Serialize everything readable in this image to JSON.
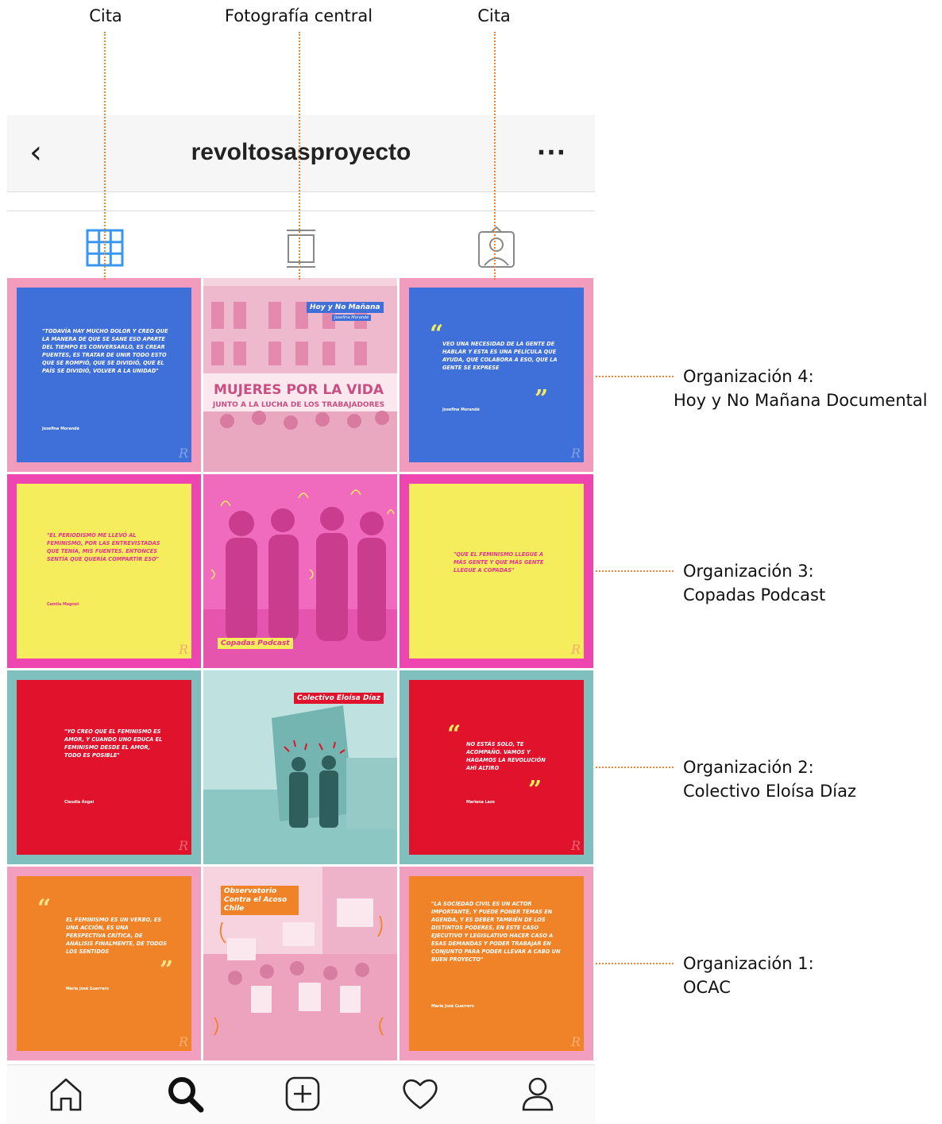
{
  "annotations": {
    "top_labels": [
      "Cita",
      "Fotografía central",
      "Cita"
    ],
    "side_labels": [
      {
        "line1": "Organización 4:",
        "line2": "Hoy y No Mañana Documental"
      },
      {
        "line1": "Organización 3:",
        "line2": "Copadas Podcast"
      },
      {
        "line1": "Organización 2:",
        "line2": "Colectivo Eloísa Díaz"
      },
      {
        "line1": "Organización 1:",
        "line2": "OCAC"
      }
    ],
    "line_color": "#e8873a"
  },
  "header": {
    "back_icon": "chevron-left-icon",
    "username": "revoltosasproyecto",
    "more_label": "···"
  },
  "tabs": [
    {
      "name": "grid",
      "icon": "grid-icon",
      "active": true
    },
    {
      "name": "feed",
      "icon": "single-post-icon",
      "active": false
    },
    {
      "name": "tagged",
      "icon": "tagged-person-icon",
      "active": false
    }
  ],
  "rows": [
    {
      "left": {
        "text": "\"Todavía hay mucho dolor y creo que la manera de que se sane eso aparte del tiempo es conversarlo, es crear puentes, es tratar de unir todo esto que se rompió, que se dividió, que el país se dividió, volver a la unidad\"",
        "author": "Josefina Morandé"
      },
      "center": {
        "tag": "Hoy y No Mañana",
        "subtag": "Josefina Morandé",
        "banner": "MUJERES POR LA VIDA",
        "banner2": "JUNTO A LA LUCHA DE LOS TRABAJADORES"
      },
      "right": {
        "text": "Veo una necesidad de la gente de hablar y esta es una película que ayuda, que colabora a eso, que la gente se exprese",
        "author": "Josefina Morandé"
      }
    },
    {
      "left": {
        "text": "\"El periodismo me llevó al feminismo, por las entrevistadas que tenía, mis fuentes. Entonces sentía que quería compartir eso\"",
        "author": "Camila Magnet"
      },
      "center": {
        "tag": "Copadas Podcast"
      },
      "right": {
        "text": "\"Que el feminismo llegue a más gente y que más gente llegue a Copadas\"",
        "author": ""
      }
    },
    {
      "left": {
        "text": "\"Yo creo que el feminismo es amor, y cuando uno educa el feminismo desde el amor, todo es posible\"",
        "author": "Claudia Ángel"
      },
      "center": {
        "tag": "Colectivo Eloísa Díaz"
      },
      "right": {
        "text": "No estás solo, te acompaño. Vamos y hagamos la revolución ahí altiro",
        "author": "Mariana Lazo"
      }
    },
    {
      "left": {
        "text": "El feminismo es un verbo, es una acción, es una perspectiva crítica, de análisis finalmente, de todos los sentidos",
        "author": "María José Guerrero"
      },
      "center": {
        "tag": "Observatorio Contra el Acoso Chile"
      },
      "right": {
        "text": "\"La sociedad civil es un actor importante, y puede poner temas en agenda, y es deber también de los distintos poderes, en este caso ejecutivo y legislativo hacer caso a esas demandas y poder trabajar en conjunto para poder llevar a cabo un buen proyecto\"",
        "author": "María José Guerrero"
      }
    }
  ],
  "colors": {
    "row1_border": "#f39bbd",
    "row1_quote_bg": "#3f6fd8",
    "row1_quote_text": "#ffffff",
    "row1_photo": "#f2c6d6",
    "row2_border": "#ef45b0",
    "row2_quote_bg": "#f6ed5c",
    "row2_quote_text": "#e8338f",
    "row2_photo": "#f06bbd",
    "row3_border": "#7fc0bf",
    "row3_quote_bg": "#e1122b",
    "row3_quote_text": "#ffffff",
    "row3_photo": "#a9d6d4",
    "row4_border": "#f29fbf",
    "row4_quote_bg": "#f08228",
    "row4_quote_text": "#ffffff",
    "row4_photo": "#f4bfd3",
    "accent_blue": "#3897f0"
  },
  "navbar": [
    {
      "icon": "home-icon"
    },
    {
      "icon": "search-icon"
    },
    {
      "icon": "add-post-icon"
    },
    {
      "icon": "heart-icon"
    },
    {
      "icon": "profile-icon"
    }
  ]
}
